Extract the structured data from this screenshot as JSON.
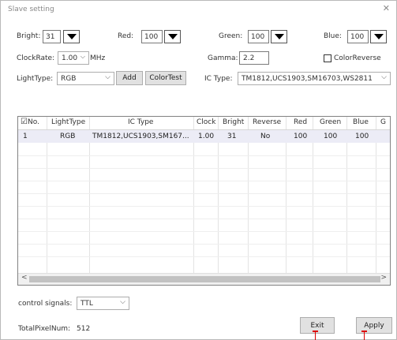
{
  "window": {
    "title": "Slave setting",
    "close_glyph": "✕"
  },
  "row1": {
    "bright_label": "Bright:",
    "bright_value": "31",
    "red_label": "Red:",
    "red_value": "100",
    "green_label": "Green:",
    "green_value": "100",
    "blue_label": "Blue:",
    "blue_value": "100"
  },
  "row2": {
    "clockrate_label": "ClockRate:",
    "clockrate_value": "1.00",
    "clockrate_unit": "MHz",
    "gamma_label": "Gamma:",
    "gamma_value": "2.2",
    "colorreverse_label": "ColorReverse",
    "colorreverse_checked": false
  },
  "row3": {
    "lighttype_label": "LightType:",
    "lighttype_value": "RGB",
    "add_button": "Add",
    "colortest_button": "ColorTest",
    "ictype_label": "IC Type:",
    "ictype_value": "TM1812,UCS1903,SM16703,WS2811"
  },
  "table": {
    "headers": [
      "No.",
      "LightType",
      "IC Type",
      "Clock",
      "Bright",
      "Reverse",
      "Red",
      "Green",
      "Blue",
      "G"
    ],
    "header_checkbox": "☑",
    "rows": [
      [
        "1",
        "RGB",
        "TM1812,UCS1903,SM167...",
        "1.00",
        "31",
        "No",
        "100",
        "100",
        "100",
        ""
      ]
    ],
    "scroll_left": "<",
    "scroll_right": ">"
  },
  "footer": {
    "control_signals_label": "control signals:",
    "control_signals_value": "TTL",
    "total_pixel_label": "TotalPixelNum:",
    "total_pixel_value": "512",
    "exit_button": "Exit",
    "apply_button": "Apply"
  },
  "colors": {
    "marker": "#dd0000",
    "selected_row": "#ececf6"
  }
}
